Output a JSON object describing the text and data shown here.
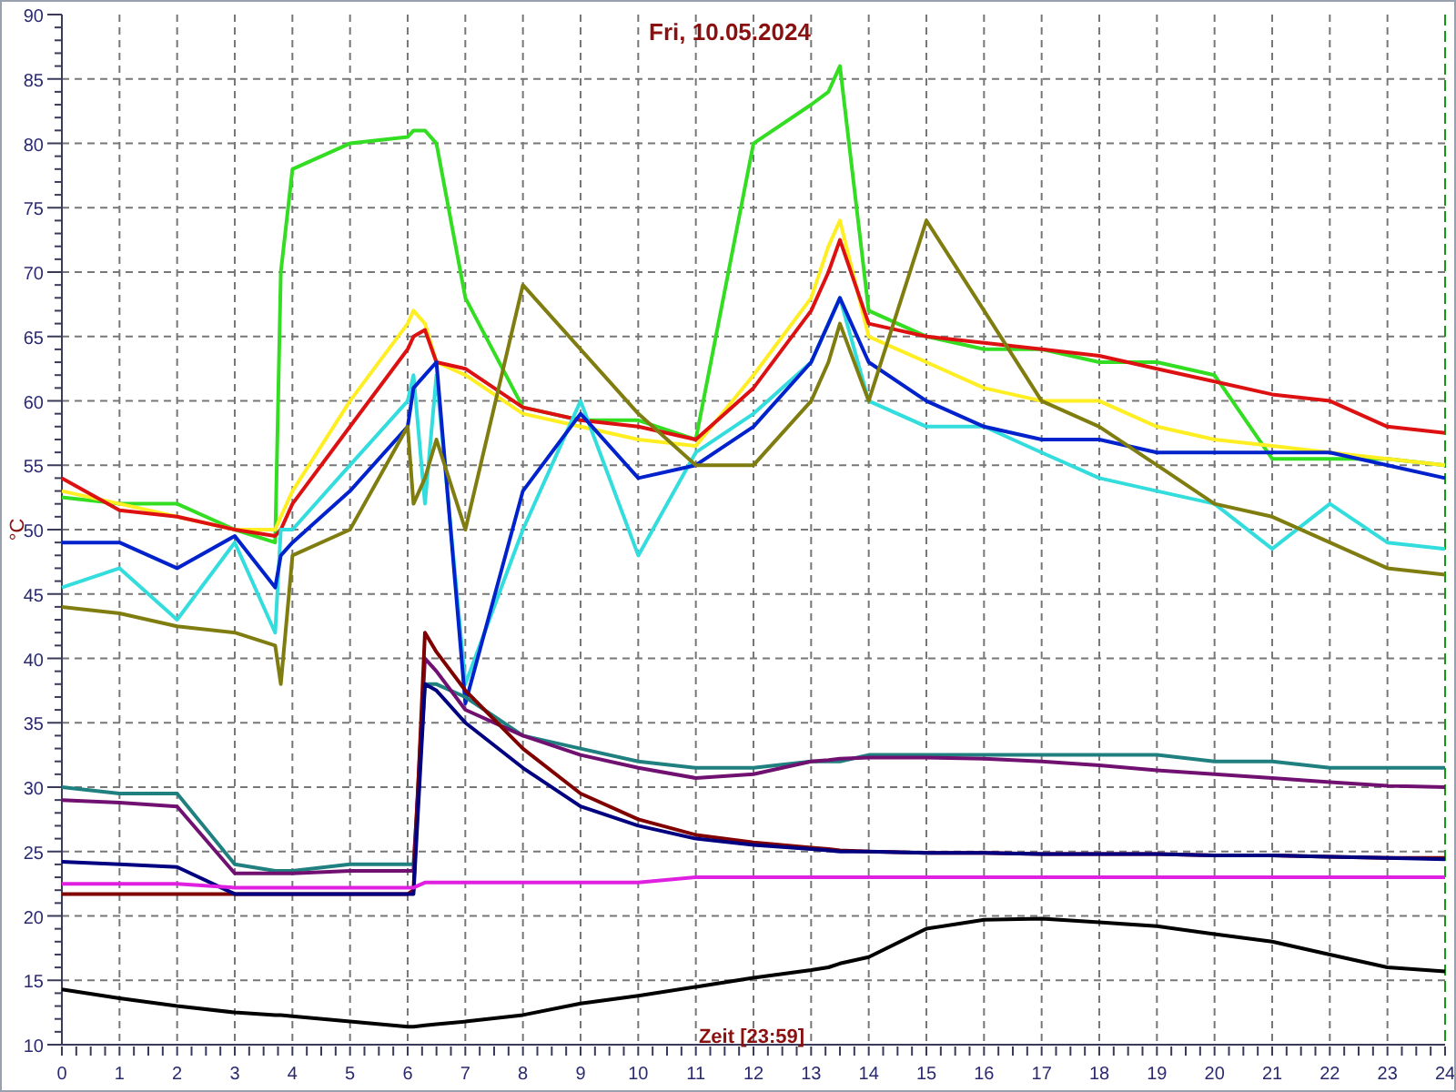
{
  "chart_data": {
    "type": "line",
    "title": "Fri, 10.05.2024",
    "xlabel": "Zeit [23:59]",
    "ylabel": "°C",
    "x": [
      0,
      1,
      2,
      3,
      3.7,
      3.8,
      4,
      5,
      6,
      6.1,
      6.3,
      6.5,
      7,
      8,
      9,
      10,
      11,
      12,
      13,
      13.3,
      13.5,
      14,
      15,
      16,
      17,
      18,
      19,
      20,
      21,
      22,
      23,
      24
    ],
    "series": [
      {
        "color": "#33dd22",
        "values": [
          52.5,
          52,
          52,
          50,
          49,
          70,
          78,
          80,
          80.5,
          81,
          81,
          80,
          68,
          59.5,
          58.5,
          58.5,
          57,
          80,
          83,
          84,
          86,
          67,
          65,
          64,
          64,
          63,
          63,
          62,
          55.5,
          55.5,
          55.5,
          55
        ]
      },
      {
        "color": "#ffee22",
        "values": [
          53,
          52,
          51,
          50,
          50,
          51,
          53,
          60,
          66,
          67,
          66,
          63,
          62,
          59,
          58,
          57,
          56.5,
          62,
          68,
          72,
          74,
          65,
          63,
          61,
          60,
          60,
          58,
          57,
          56.5,
          56,
          55.5,
          55
        ]
      },
      {
        "color": "#dd1111",
        "values": [
          54,
          51.5,
          51,
          50,
          49.5,
          50,
          52,
          58,
          64,
          65,
          65.5,
          63,
          62.5,
          59.5,
          58.5,
          58,
          57,
          61,
          67,
          70,
          72.5,
          66,
          65,
          64.5,
          64,
          63.5,
          62.5,
          61.5,
          60.5,
          60,
          58,
          57.5
        ]
      },
      {
        "color": "#33dddd",
        "values": [
          45.5,
          47,
          43,
          49,
          42,
          50,
          50,
          55,
          60,
          62,
          52,
          62,
          38,
          50,
          60,
          48,
          56,
          59,
          63,
          66,
          68,
          60,
          58,
          58,
          56,
          54,
          53,
          52,
          48.5,
          52,
          49,
          48.5
        ]
      },
      {
        "color": "#0022cc",
        "values": [
          49,
          49,
          47,
          49.5,
          45.5,
          48,
          49,
          53,
          58,
          61,
          62,
          63,
          36.5,
          53,
          59,
          54,
          55,
          58,
          63,
          66,
          68,
          63,
          60,
          58,
          57,
          57,
          56,
          56,
          56,
          56,
          55,
          54
        ]
      },
      {
        "color": "#807d10",
        "values": [
          44,
          43.5,
          42.5,
          42,
          41,
          38,
          48,
          50,
          58,
          52,
          54,
          57,
          50,
          69,
          64,
          59,
          55,
          55,
          60,
          63,
          66,
          60,
          74,
          67,
          60,
          58,
          55,
          52,
          51,
          49,
          47,
          46.5
        ]
      },
      {
        "color": "#208080",
        "values": [
          30,
          29.5,
          29.5,
          24,
          23.5,
          23.5,
          23.5,
          24,
          24,
          24,
          38,
          38,
          37,
          34,
          33,
          32,
          31.5,
          31.5,
          32,
          32,
          32,
          32.5,
          32.5,
          32.5,
          32.5,
          32.5,
          32.5,
          32,
          32,
          31.5,
          31.5,
          31.5
        ]
      },
      {
        "color": "#701070",
        "values": [
          29,
          28.8,
          28.5,
          23.3,
          23.3,
          23.3,
          23.3,
          23.5,
          23.5,
          23.5,
          40,
          39,
          36,
          34,
          32.5,
          31.5,
          30.7,
          31,
          32,
          32.1,
          32.2,
          32.3,
          32.3,
          32.2,
          32,
          31.7,
          31.3,
          31,
          30.7,
          30.4,
          30.1,
          30
        ]
      },
      {
        "color": "#800000",
        "values": [
          21.7,
          21.7,
          21.7,
          21.7,
          21.7,
          21.7,
          21.7,
          21.7,
          21.7,
          22,
          42,
          40.5,
          37.5,
          33,
          29.5,
          27.5,
          26.3,
          25.7,
          25.3,
          25.2,
          25.1,
          25,
          24.9,
          24.9,
          24.8,
          24.8,
          24.8,
          24.7,
          24.7,
          24.6,
          24.5,
          24.5
        ]
      },
      {
        "color": "#000080",
        "values": [
          24.2,
          24,
          23.8,
          21.7,
          21.7,
          21.7,
          21.7,
          21.7,
          21.7,
          21.7,
          38,
          37.5,
          35,
          31.5,
          28.5,
          27,
          26,
          25.5,
          25.2,
          25.1,
          25,
          25,
          24.9,
          24.9,
          24.8,
          24.8,
          24.8,
          24.7,
          24.7,
          24.6,
          24.5,
          24.4
        ]
      },
      {
        "color": "#e020e0",
        "values": [
          22.5,
          22.5,
          22.5,
          22.2,
          22.2,
          22.2,
          22.2,
          22.2,
          22.2,
          22.2,
          22.6,
          22.6,
          22.6,
          22.6,
          22.6,
          22.6,
          23,
          23,
          23,
          23,
          23,
          23,
          23,
          23,
          23,
          23,
          23,
          23,
          23,
          23,
          23,
          23
        ]
      },
      {
        "color": "#000000",
        "values": [
          14.3,
          13.6,
          13,
          12.5,
          12.3,
          12.3,
          12.2,
          11.8,
          11.4,
          11.4,
          11.5,
          11.6,
          11.8,
          12.3,
          13.2,
          13.8,
          14.5,
          15.2,
          15.8,
          16,
          16.3,
          16.8,
          19,
          19.7,
          19.8,
          19.5,
          19.2,
          18.6,
          18,
          17,
          16,
          15.7
        ]
      }
    ],
    "xlim": [
      0,
      24
    ],
    "ylim": [
      10,
      90
    ],
    "grid": true,
    "xticks": [
      0,
      1,
      2,
      3,
      4,
      5,
      6,
      7,
      8,
      9,
      10,
      11,
      12,
      13,
      14,
      15,
      16,
      17,
      18,
      19,
      20,
      21,
      22,
      23,
      24
    ],
    "yticks": [
      10,
      15,
      20,
      25,
      30,
      35,
      40,
      45,
      50,
      55,
      60,
      65,
      70,
      75,
      80,
      85,
      90
    ]
  }
}
